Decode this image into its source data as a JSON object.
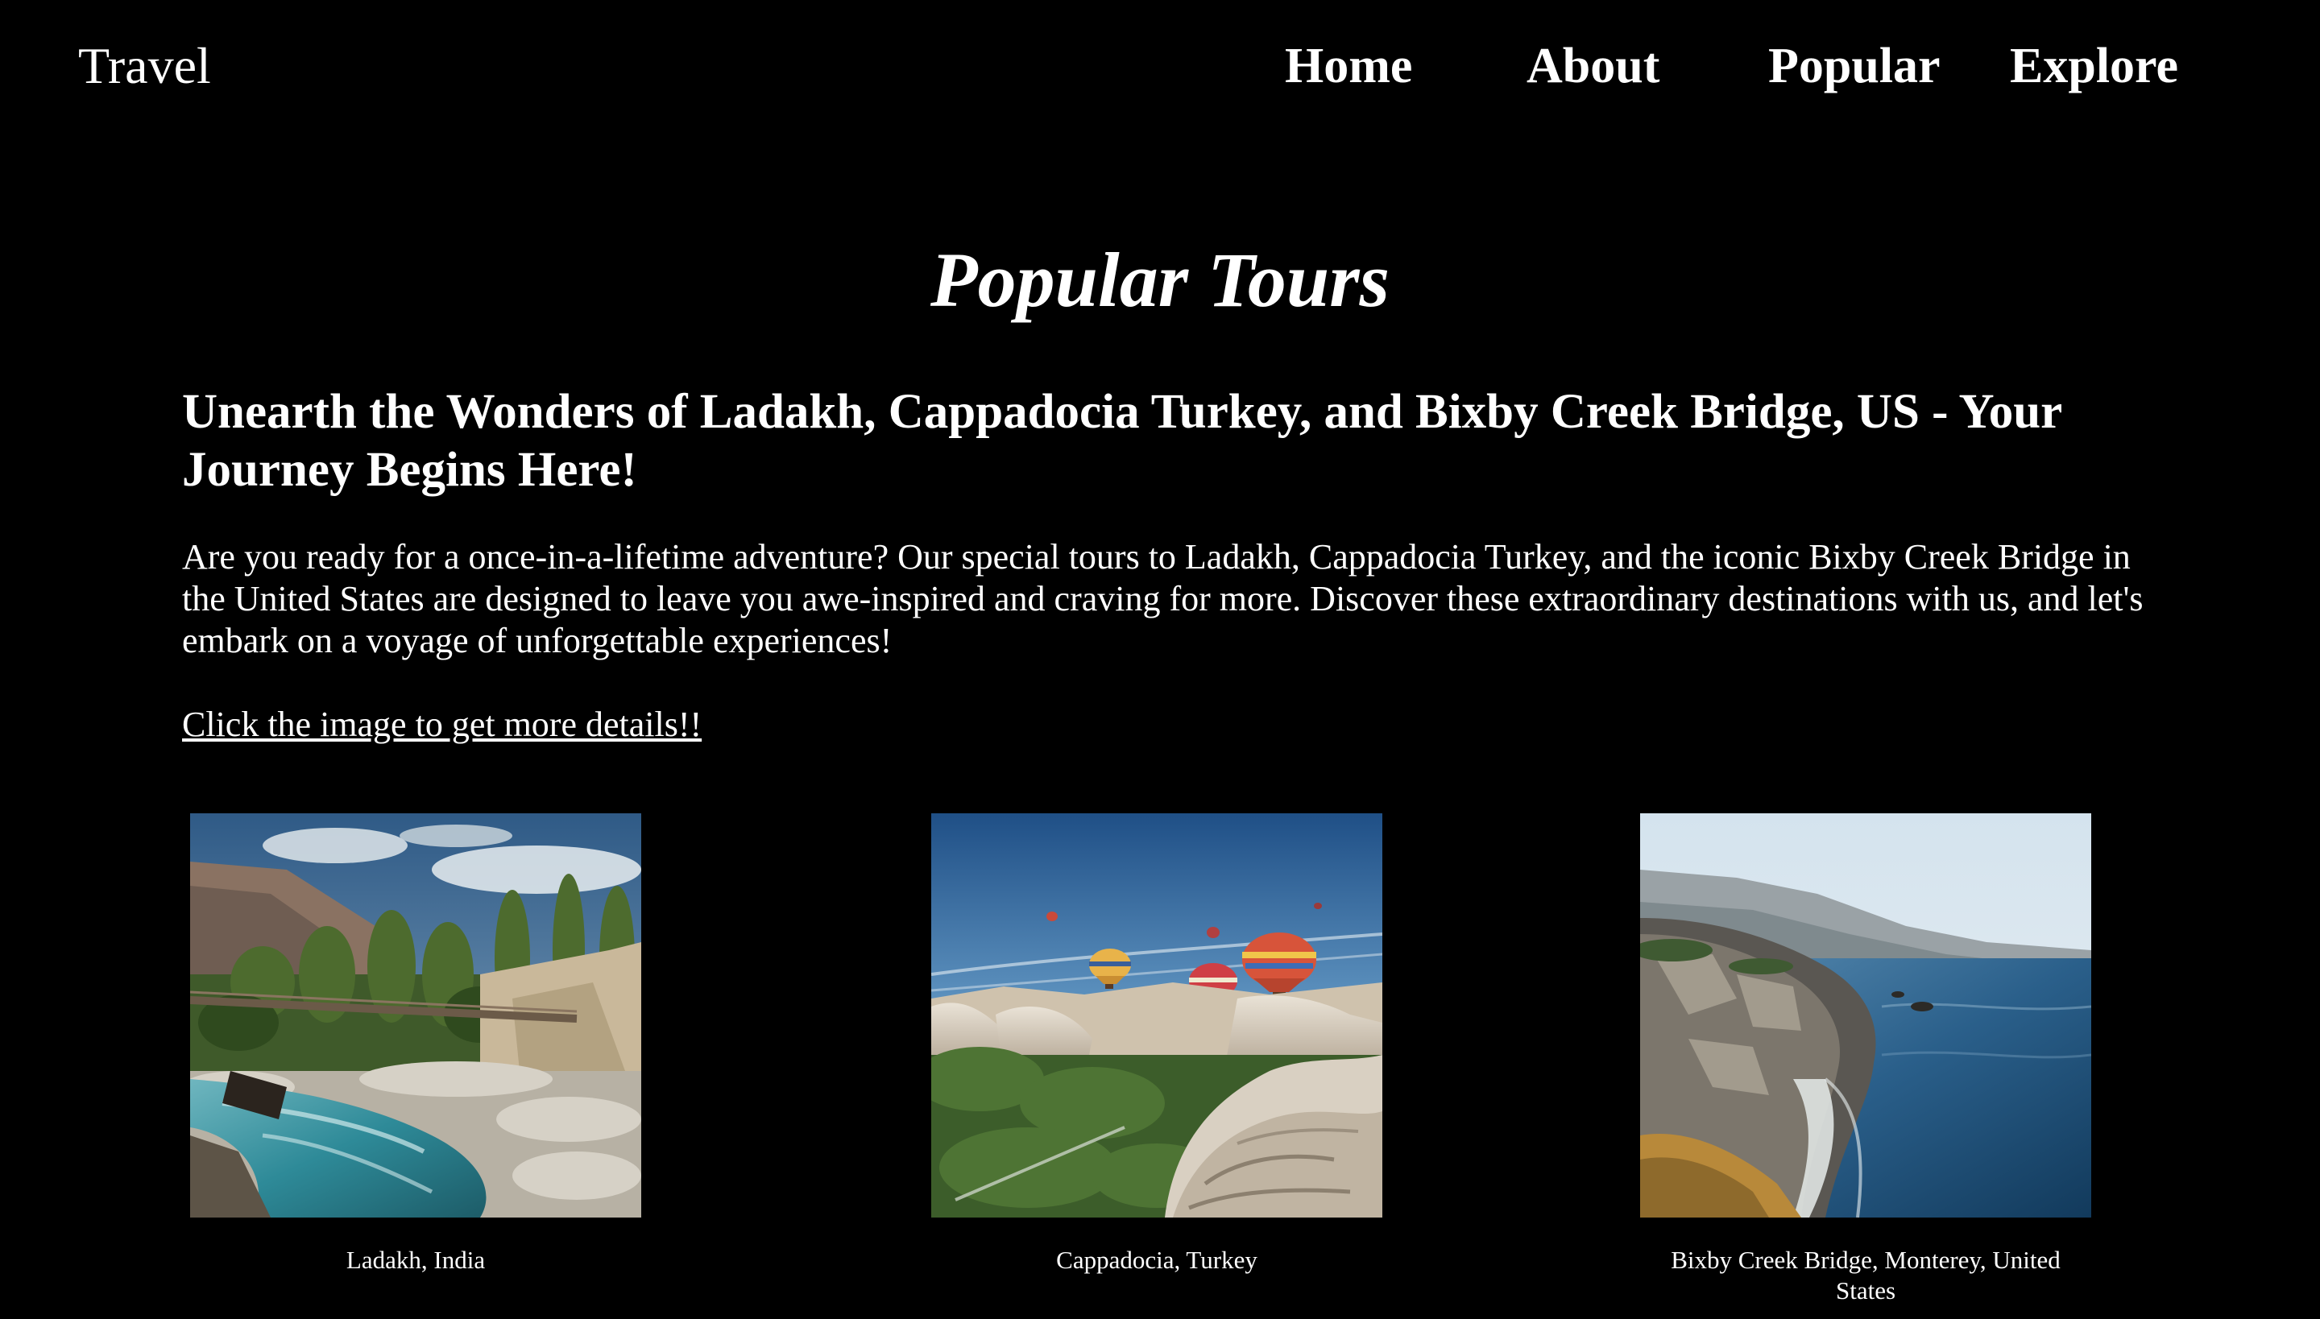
{
  "header": {
    "logo": "Travel",
    "nav": {
      "home": "Home",
      "about": "About",
      "popular": "Popular",
      "explore": "Explore"
    }
  },
  "main": {
    "title": "Popular Tours",
    "headline": "Unearth the Wonders of Ladakh, Cappadocia Turkey, and Bixby Creek Bridge, US - Your Journey Begins Here!",
    "intro": "Are you ready for a once-in-a-lifetime adventure? Our special tours to Ladakh, Cappadocia Turkey, and the iconic Bixby Creek Bridge in the United States are designed to leave you awe-inspired and craving for more. Discover these extraordinary destinations with us, and let's embark on a voyage of unforgettable experiences!",
    "cta": "Click the image to get more details!!"
  },
  "tours": [
    {
      "caption": "Ladakh, India"
    },
    {
      "caption": "Cappadocia, Turkey"
    },
    {
      "caption": "Bixby Creek Bridge, Monterey, United States"
    }
  ],
  "colors": {
    "background": "#000000",
    "text": "#ffffff"
  }
}
